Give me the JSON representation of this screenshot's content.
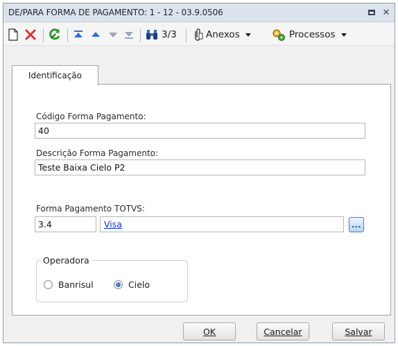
{
  "window": {
    "title": "DE/PARA FORMA DE PAGAMENTO: 1 - 12 - 03.9.0506",
    "restore_icon": "restore-icon",
    "close_glyph": "✕"
  },
  "toolbar": {
    "record_position": "3/3",
    "attachments_label": "Anexos",
    "processes_label": "Processos"
  },
  "tabs": [
    {
      "label": "Identificação",
      "active": true
    }
  ],
  "form": {
    "codigo_label": "Código Forma Pagamento:",
    "codigo_value": "40",
    "descricao_label": "Descrição Forma Pagamento:",
    "descricao_value": "Teste Baixa Cielo P2",
    "totvs_label": "Forma Pagamento TOTVS:",
    "totvs_code": "3.4",
    "totvs_name": "Visa",
    "lookup_label": "..."
  },
  "operadora": {
    "title": "Operadora",
    "options": [
      {
        "label": "Banrisul",
        "selected": false
      },
      {
        "label": "Cielo",
        "selected": true
      }
    ]
  },
  "footer": {
    "ok_label": "OK",
    "cancel_label": "Cancelar",
    "save_label": "Salvar"
  },
  "colors": {
    "titlebar": "#dbe3ec",
    "link": "#0b2fdb",
    "delete_red": "#e0312a",
    "refresh_green": "#2f9a2c",
    "nav_blue": "#2f6fd6"
  }
}
